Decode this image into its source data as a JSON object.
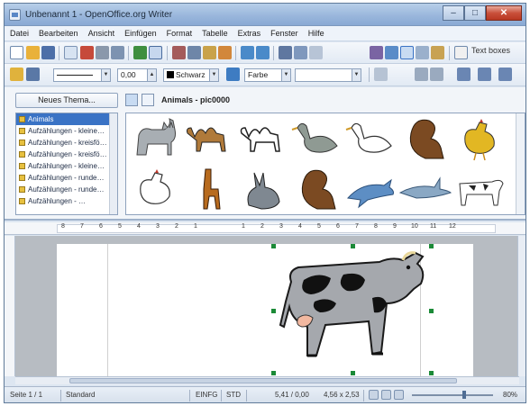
{
  "window": {
    "title": "Unbenannt 1 - OpenOffice.org Writer"
  },
  "menubar": [
    "Datei",
    "Bearbeiten",
    "Ansicht",
    "Einfügen",
    "Format",
    "Tabelle",
    "Extras",
    "Fenster",
    "Hilfe"
  ],
  "toolbar": {
    "textbox_label": "Text boxes",
    "line_width": "0,00",
    "line_color": "Schwarz",
    "area_style": "Farbe"
  },
  "gallery": {
    "new_theme": "Neues Thema...",
    "title": "Animals - pic0000",
    "themes": [
      {
        "label": "Animals",
        "selected": true
      },
      {
        "label": "Aufzählungen - kleine…",
        "selected": false
      },
      {
        "label": "Aufzählungen - kreisfö…",
        "selected": false
      },
      {
        "label": "Aufzählungen - kreisfö…",
        "selected": false
      },
      {
        "label": "Aufzählungen - kleine…",
        "selected": false
      },
      {
        "label": "Aufzählungen - runde…",
        "selected": false
      },
      {
        "label": "Aufzählungen - runde…",
        "selected": false
      },
      {
        "label": "Aufzählungen - …",
        "selected": false
      }
    ],
    "items": [
      "cat",
      "camel",
      "camel",
      "goose",
      "goose",
      "squirrel",
      "chicken",
      "chicken",
      "giraffe",
      "rabbit",
      "squirrel",
      "dolphin",
      "shark",
      "cow"
    ]
  },
  "ruler": {
    "numbers": [
      "8",
      "7",
      "6",
      "5",
      "4",
      "3",
      "2",
      "1",
      "1",
      "2",
      "3",
      "4",
      "5",
      "6",
      "7",
      "8",
      "9",
      "10",
      "11",
      "12"
    ]
  },
  "status": {
    "page": "Seite 1 / 1",
    "style": "Standard",
    "mode": "EINFG",
    "std": "STD",
    "position": "5,41 / 0,00",
    "size": "4,56 x 2,53",
    "zoom": "80%",
    "zoom_fraction": 0.65
  }
}
